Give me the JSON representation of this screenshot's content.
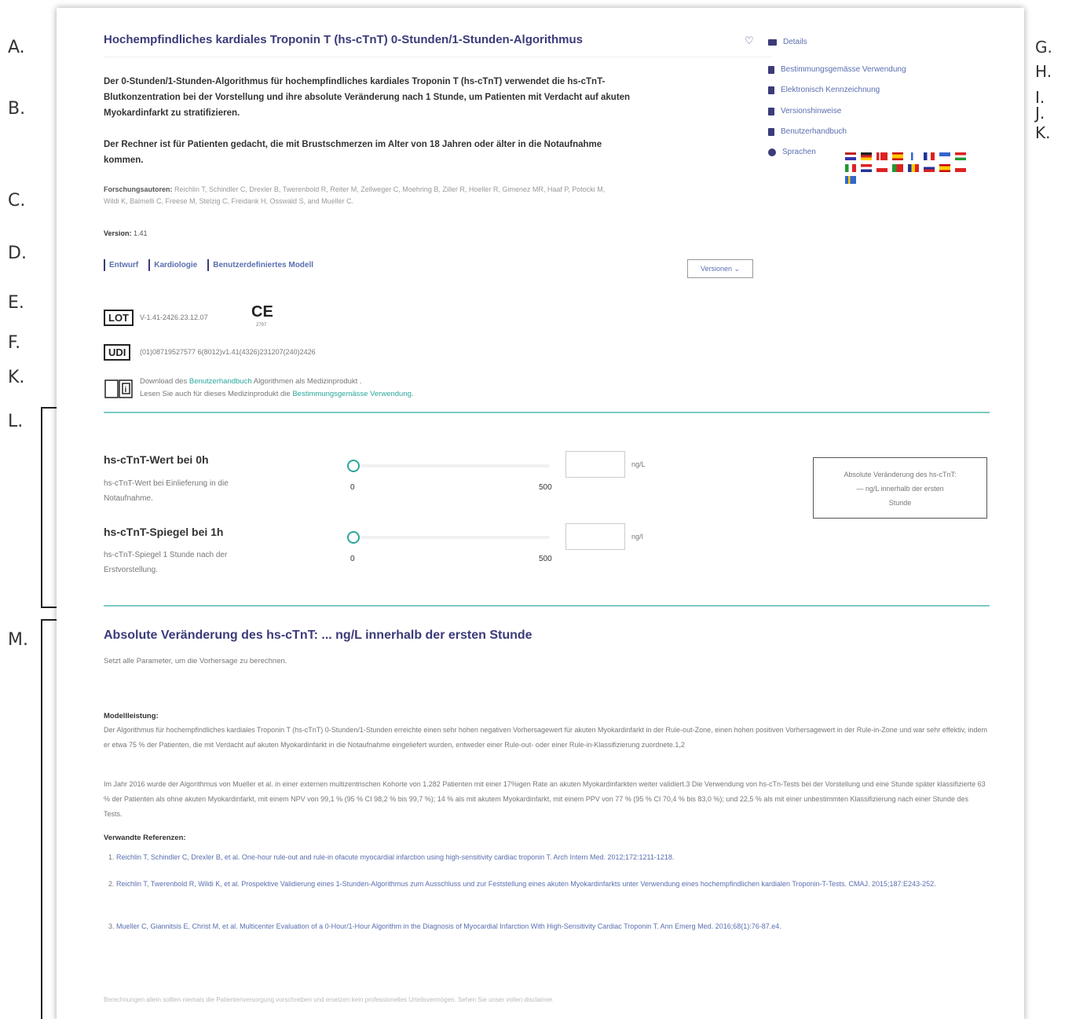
{
  "annotations": {
    "left": [
      "A.",
      "B.",
      "C.",
      "D.",
      "E.",
      "F.",
      "K.",
      "L.",
      "M."
    ],
    "right": [
      "G.",
      "H.",
      "I.",
      "J.",
      "K."
    ]
  },
  "header": {
    "title": "Hochempfindliches kardiales Troponin T (hs-cTnT) 0-Stunden/1-Stunden-Algorithmus"
  },
  "description": {
    "p1": "Der 0-Stunden/1-Stunden-Algorithmus für hochempfindliches kardiales Troponin T (hs-cTnT) verwendet die hs-cTnT-Blutkonzentration bei der Vorstellung und ihre absolute Veränderung nach 1 Stunde, um Patienten mit Verdacht auf akuten Myokardinfarkt zu stratifizieren.",
    "p2": "Der Rechner ist für Patienten gedacht, die mit Brustschmerzen im Alter von 18 Jahren oder älter in die Notaufnahme kommen."
  },
  "authors": {
    "label": "Forschungsautoren:",
    "names": "Reichlin T, Schindler C, Drexler B, Twerenbold R, Reiter M, Zellweger C, Moehring B, Ziller R, Hoeller R, Gimenez MR, Haaf P, Potocki M, Wildi K, Balmelli C, Freese M, Stelzig C, Freidank H, Osswald S, and Mueller C."
  },
  "version": {
    "label": "Version:",
    "value": "1.41"
  },
  "tags": [
    "Entwurf",
    "Kardiologie",
    "Benutzerdefiniertes Modell"
  ],
  "versions_button": "Versionen ⌄",
  "lot": {
    "label": "LOT",
    "value": "V-1.41-2426.23.12.07",
    "ce": "CE",
    "ce_sub": "2797"
  },
  "udi": {
    "label": "UDI",
    "value": "(01)08719527577 6(8012)v1.41(4326)231207(240)2426"
  },
  "download": {
    "line1_pre": "Download des ",
    "line1_link": "Benutzerhandbuch",
    "line1_post": " Algorithmen als Medizinprodukt .",
    "line2_pre": "Lesen Sie auch für dieses Medizinprodukt die ",
    "line2_link": "Bestimmungsgemässe Verwendung",
    "line2_post": "."
  },
  "sidebar": {
    "details": "Details",
    "links": [
      "Bestimmungsgemässe Verwendung",
      "Elektronisch Kennzeichnung",
      "Versionshinweise",
      "Benutzerhandbuch"
    ],
    "languages": "Sprachen"
  },
  "inputs": [
    {
      "title": "hs-cTnT-Wert bei 0h",
      "subtitle": "hs-cTnT-Wert bei Einlieferung in die Notaufnahme.",
      "min": "0",
      "max": "500",
      "unit": "ng/L",
      "value": ""
    },
    {
      "title": "hs-cTnT-Spiegel bei 1h",
      "subtitle": "hs-cTnT-Spiegel 1 Stunde nach der Erstvorstellung.",
      "min": "0",
      "max": "500",
      "unit": "ng/l",
      "value": ""
    }
  ],
  "result_box": {
    "line1": "Absolute Veränderung des hs-cTnT:",
    "line2": "— ng/L innerhalb der ersten",
    "line3": "Stunde"
  },
  "result": {
    "title": "Absolute Veränderung des hs-cTnT: ... ng/L innerhalb der ersten Stunde",
    "subtitle": "Setzt alle Parameter, um die Vorhersage zu berechnen."
  },
  "performance": {
    "heading": "Modellleistung:",
    "p1": "Der Algorithmus für hochempfindliches kardiales Troponin T (hs-cTnT) 0-Stunden/1-Stunden erreichte einen sehr hohen negativen Vorhersagewert für akuten Myokardinfarkt in der Rule-out-Zone, einen hohen positiven Vorhersagewert in der Rule-in-Zone und war sehr effektiv, indem er etwa 75 % der Patienten, die mit Verdacht auf akuten Myokardinfarkt in die Notaufnahme eingeliefert wurden, entweder einer Rule-out- oder einer Rule-in-Klassifizierung zuordnete.1,2",
    "p2": "Im Jahr 2016 wurde der Algorithmus von Mueller et al. in einer externen multizentrischen Kohorte von 1.282 Patienten mit einer 17%igen Rate an akuten Myokardinfarkten weiter validiert.3 Die Verwendung von hs-cTn-Tests bei der Vorstellung und eine Stunde später klassifizierte 63 % der Patienten als ohne akuten Myokardinfarkt, mit einem NPV von 99,1 % (95 % CI 98,2 % bis 99,7 %); 14 % als mit akutem Myokardinfarkt, mit einem PPV von 77 % (95 % CI 70,4 % bis 83,0 %); und 22,5 % als mit einer unbestimmten Klassifizierung nach einer Stunde des Tests."
  },
  "references": {
    "heading": "Verwandte Referenzen:",
    "items": [
      {
        "num": "1.",
        "text": "Reichlin T, Schindler C, Drexler B, et al. One-hour rule-out and rule-in ofacute myocardial infarction using high-sensitivity cardiac troponin T. Arch Intern Med. 2012;172:1211-1218."
      },
      {
        "num": "2.",
        "text": "Reichlin T, Twerenbold R, Wildi K, et al. Prospektive Validierung eines 1-Stunden-Algorithmus zum Ausschluss und zur Feststellung eines akuten Myokardinfarkts unter Verwendung eines hochempfindlichen kardialen Troponin-T-Tests. CMAJ. 2015;187:E243-252."
      },
      {
        "num": "3.",
        "text": "Mueller C, Giannitsis E, Christ M, et al. Multicenter Evaluation of a 0-Hour/1-Hour Algorithm in the Diagnosis of Myocardial Infarction With High-Sensitivity Cardiac Troponin T. Ann Emerg Med. 2016;68(1):76-87.e4."
      }
    ]
  },
  "disclaimer": "Berechnungen allein sollten niemals die Patientenversorgung vorschreiben und ersetzen kein professionelles Urteilsvermögen. Sehen Sie unser vollen disclaimer.",
  "colors": {
    "accent": "#3b3b7a",
    "teal": "#2aa79b",
    "link": "#5a6fb0"
  }
}
